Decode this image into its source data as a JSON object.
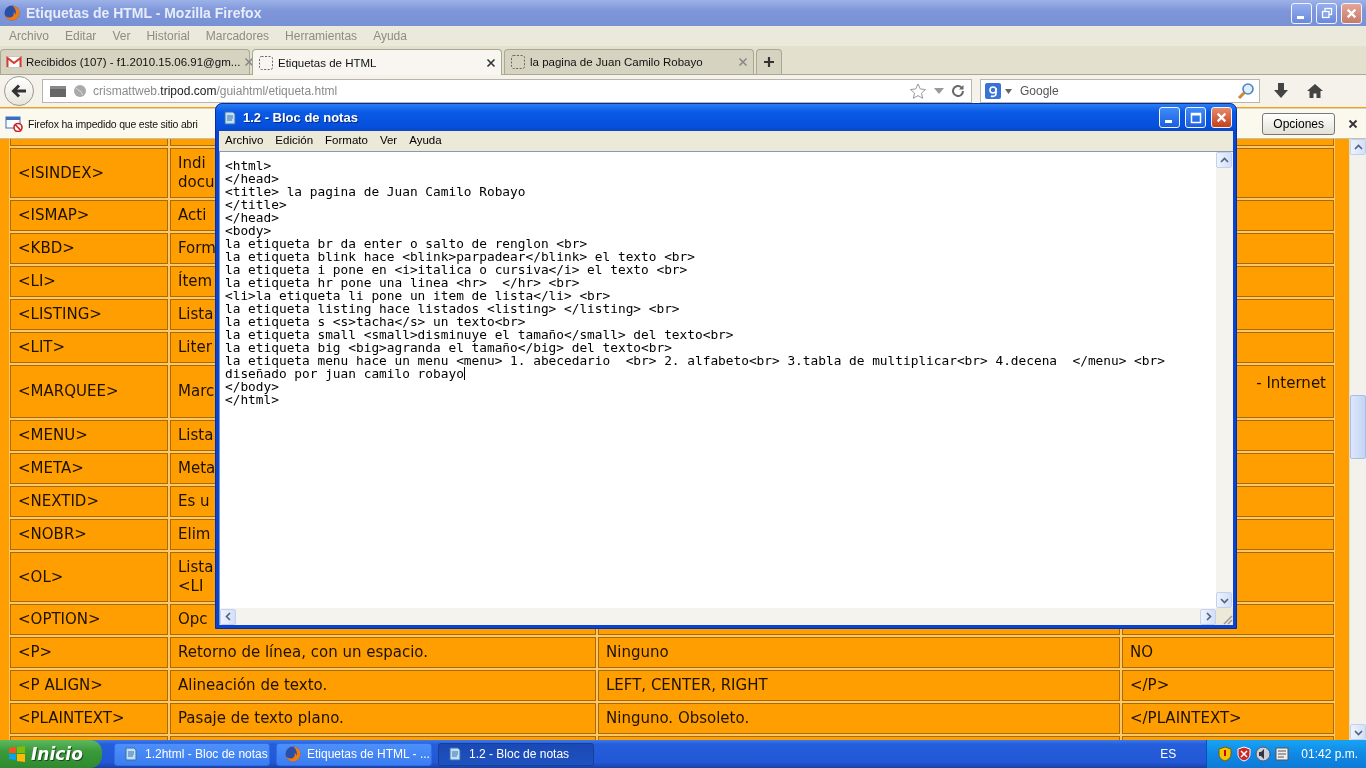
{
  "browser": {
    "title": "Etiquetas de HTML - Mozilla Firefox",
    "menu": [
      "Archivo",
      "Editar",
      "Ver",
      "Historial",
      "Marcadores",
      "Herramientas",
      "Ayuda"
    ],
    "tabs": [
      {
        "label": "Recibidos (107) - f1.2010.15.06.91@gm...",
        "selected": false,
        "kind": "mail"
      },
      {
        "label": "Etiquetas de HTML",
        "selected": true,
        "kind": "page"
      },
      {
        "label": "la pagina de Juan Camilo Robayo",
        "selected": false,
        "kind": "page"
      }
    ],
    "address": {
      "prefix": "crismattweb.",
      "domain": "tripod.com",
      "path": "/guiahtml/etiqueta.html"
    },
    "search": {
      "placeholder": "Google"
    },
    "notification": {
      "text": "Firefox ha impedido que este sitio abri",
      "button": "Opciones"
    }
  },
  "table": {
    "rows": [
      {
        "tag": "<ISINDEX>",
        "description": [
          "Indi",
          "docu"
        ]
      },
      {
        "tag": "<ISMAP>",
        "description": [
          "Acti"
        ]
      },
      {
        "tag": "<KBD>",
        "description": [
          "Form"
        ]
      },
      {
        "tag": "<LI>",
        "description": [
          "Ítem"
        ]
      },
      {
        "tag": "<LISTING>",
        "description": [
          "Lista"
        ]
      },
      {
        "tag": "<LIT>",
        "description": [
          "Liter"
        ]
      },
      {
        "tag": "<MARQUEE>",
        "description": [
          "Marc"
        ],
        "closing": {
          "text": "- Internet",
          "clipped_left": true
        }
      },
      {
        "tag": "<MENU>",
        "description": [
          "Lista"
        ]
      },
      {
        "tag": "<META>",
        "description": [
          "Meta"
        ]
      },
      {
        "tag": "<NEXTID>",
        "description": [
          "Es u"
        ]
      },
      {
        "tag": "<NOBR>",
        "description": [
          "Elim"
        ]
      },
      {
        "tag": "<OL>",
        "description": [
          "Lista",
          "<LI"
        ]
      },
      {
        "tag": "<OPTION>",
        "description": [
          "Opc"
        ]
      },
      {
        "tag": "<P>",
        "description": [
          "Retorno de línea, con un espacio."
        ],
        "attributes": "Ninguno",
        "closing": {
          "text": "NO",
          "clipped_left": false
        }
      },
      {
        "tag": "<P ALIGN>",
        "description": [
          "Alineación de texto."
        ],
        "attributes": "LEFT, CENTER, RIGHT",
        "closing": {
          "text": "</P>",
          "clipped_left": false
        }
      },
      {
        "tag": "<PLAINTEXT>",
        "description": [
          "Pasaje de texto plano."
        ],
        "attributes": "Ninguno. Obsoleto.",
        "closing": {
          "text": "</PLAINTEXT>",
          "clipped_left": false
        }
      }
    ]
  },
  "notepad": {
    "title": "1.2 - Bloc de notas",
    "menu": [
      "Archivo",
      "Edición",
      "Formato",
      "Ver",
      "Ayuda"
    ],
    "lines": [
      {
        "text": "<html>",
        "caret": false
      },
      {
        "text": "</head>",
        "caret": false
      },
      {
        "text": "<title> la pagina de Juan Camilo Robayo",
        "caret": false
      },
      {
        "text": "</title>",
        "caret": false
      },
      {
        "text": "</head>",
        "caret": false
      },
      {
        "text": "<body>",
        "caret": false
      },
      {
        "text": "la etiqueta br da enter o salto de renglon <br>",
        "caret": false
      },
      {
        "text": "la etiqueta blink hace <blink>parpadear</blink> el texto <br>",
        "caret": false
      },
      {
        "text": "la etiqueta i pone en <i>italica o cursiva</i> el texto <br>",
        "caret": false
      },
      {
        "text": "la etiqueta hr pone una linea <hr>  </hr> <br>",
        "caret": false
      },
      {
        "text": "<li>la etiqueta li pone un item de lista</li> <br>",
        "caret": false
      },
      {
        "text": "la etiqueta listing hace listados <listing> </listing> <br>",
        "caret": false
      },
      {
        "text": "la etiqueta s <s>tacha</s> un texto<br>",
        "caret": false
      },
      {
        "text": "la etiqueta small <small>disminuye el tamaño</small> del texto<br>",
        "caret": false
      },
      {
        "text": "la etiqueta big <big>agranda el tamaño</big> del texto<br>",
        "caret": false
      },
      {
        "text": "la etiqueta menu hace un menu <menu> 1. abecedario  <br> 2. alfabeto<br> 3.tabla de multiplicar<br> 4.decena  </menu> <br>",
        "caret": false
      },
      {
        "text": "diseñado por juan camilo robayo",
        "caret": true
      },
      {
        "text": "</body>",
        "caret": false
      },
      {
        "text": "</html>",
        "caret": false
      }
    ]
  },
  "taskbar": {
    "start": "Inicio",
    "tasks": [
      {
        "label": "1.2html - Bloc de notas",
        "kind": "notepad",
        "selected": false
      },
      {
        "label": "Etiquetas de HTML - ...",
        "kind": "firefox",
        "selected": false
      },
      {
        "label": "1.2 - Bloc de notas",
        "kind": "notepad",
        "selected": true
      }
    ],
    "language": "ES",
    "clock": "01:42 p.m."
  }
}
